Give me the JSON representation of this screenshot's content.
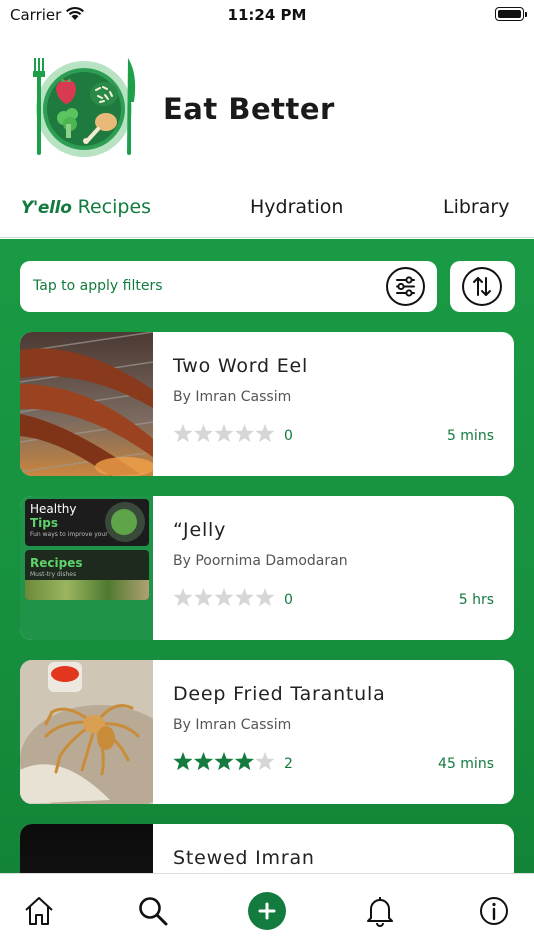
{
  "status_bar": {
    "carrier": "Carrier",
    "time": "11:24 PM"
  },
  "app": {
    "title": "Eat Better"
  },
  "tabs": [
    {
      "brand": "Y'ello",
      "label": "Recipes",
      "active": true
    },
    {
      "label": "Hydration",
      "active": false
    },
    {
      "label": "Library",
      "active": false
    }
  ],
  "filters": {
    "prompt": "Tap to apply filters"
  },
  "recipes": [
    {
      "title": "Two Word Eel",
      "author": "By Imran Cassim",
      "rating": 0,
      "rating_count": "0",
      "time": "5 mins"
    },
    {
      "title": "“Jelly",
      "author": "By Poornima Damodaran",
      "rating": 0,
      "rating_count": "0",
      "time": "5 hrs",
      "image_text": {
        "tips_heading": "Healthy",
        "tips_sub": "Tips",
        "tips_caption": "Fun ways to improve your nutrition",
        "recipes_heading": "Recipes",
        "recipes_caption": "Must-try dishes"
      }
    },
    {
      "title": "Deep Fried Tarantula",
      "author": "By Imran Cassim",
      "rating": 4,
      "rating_count": "2",
      "time": "45 mins"
    },
    {
      "title": "Stewed Imran"
    }
  ],
  "colors": {
    "brand_green": "#137b3e",
    "background_green": "#1a9a44",
    "star_empty": "#d6d6d6"
  },
  "nav": [
    "home-icon",
    "search-icon",
    "add-icon",
    "bell-icon",
    "info-icon"
  ]
}
